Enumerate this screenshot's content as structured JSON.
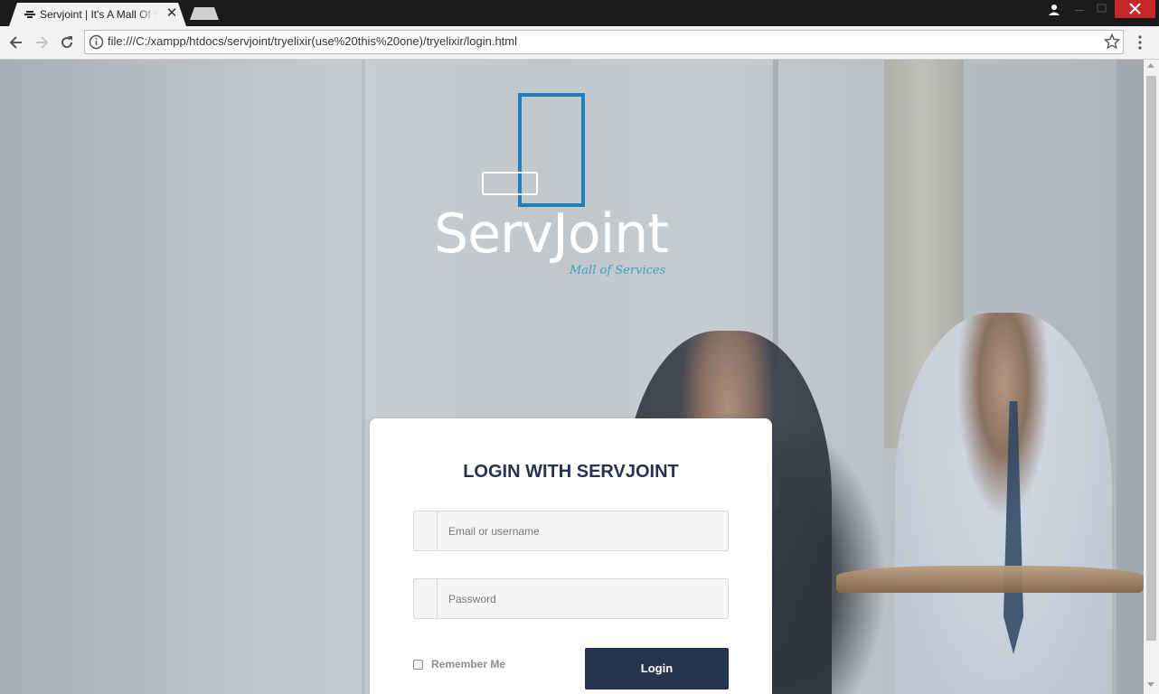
{
  "browser": {
    "tab_title": "Servjoint | It's A Mall Of Services",
    "url": "file:///C:/xampp/htdocs/servjoint/tryelixir(use%20this%20one)/tryelixir/login.html",
    "icons": [
      "favicon-icon",
      "tab-close-icon",
      "new-tab-icon",
      "profile-icon",
      "minimize-icon",
      "maximize-icon",
      "window-close-icon",
      "back-icon",
      "forward-icon",
      "reload-icon",
      "info-icon",
      "bookmark-star-icon",
      "menu-icon"
    ]
  },
  "logo": {
    "name": "ServJoint",
    "tagline": "Mall of Services",
    "accent_color": "#1d7fbd"
  },
  "login": {
    "title": "LOGIN WITH SERVJOINT",
    "email_placeholder": "Email or username",
    "password_placeholder": "Password",
    "remember_label": "Remember Me",
    "remember_checked": false,
    "button_label": "Login",
    "button_color": "#253450"
  }
}
